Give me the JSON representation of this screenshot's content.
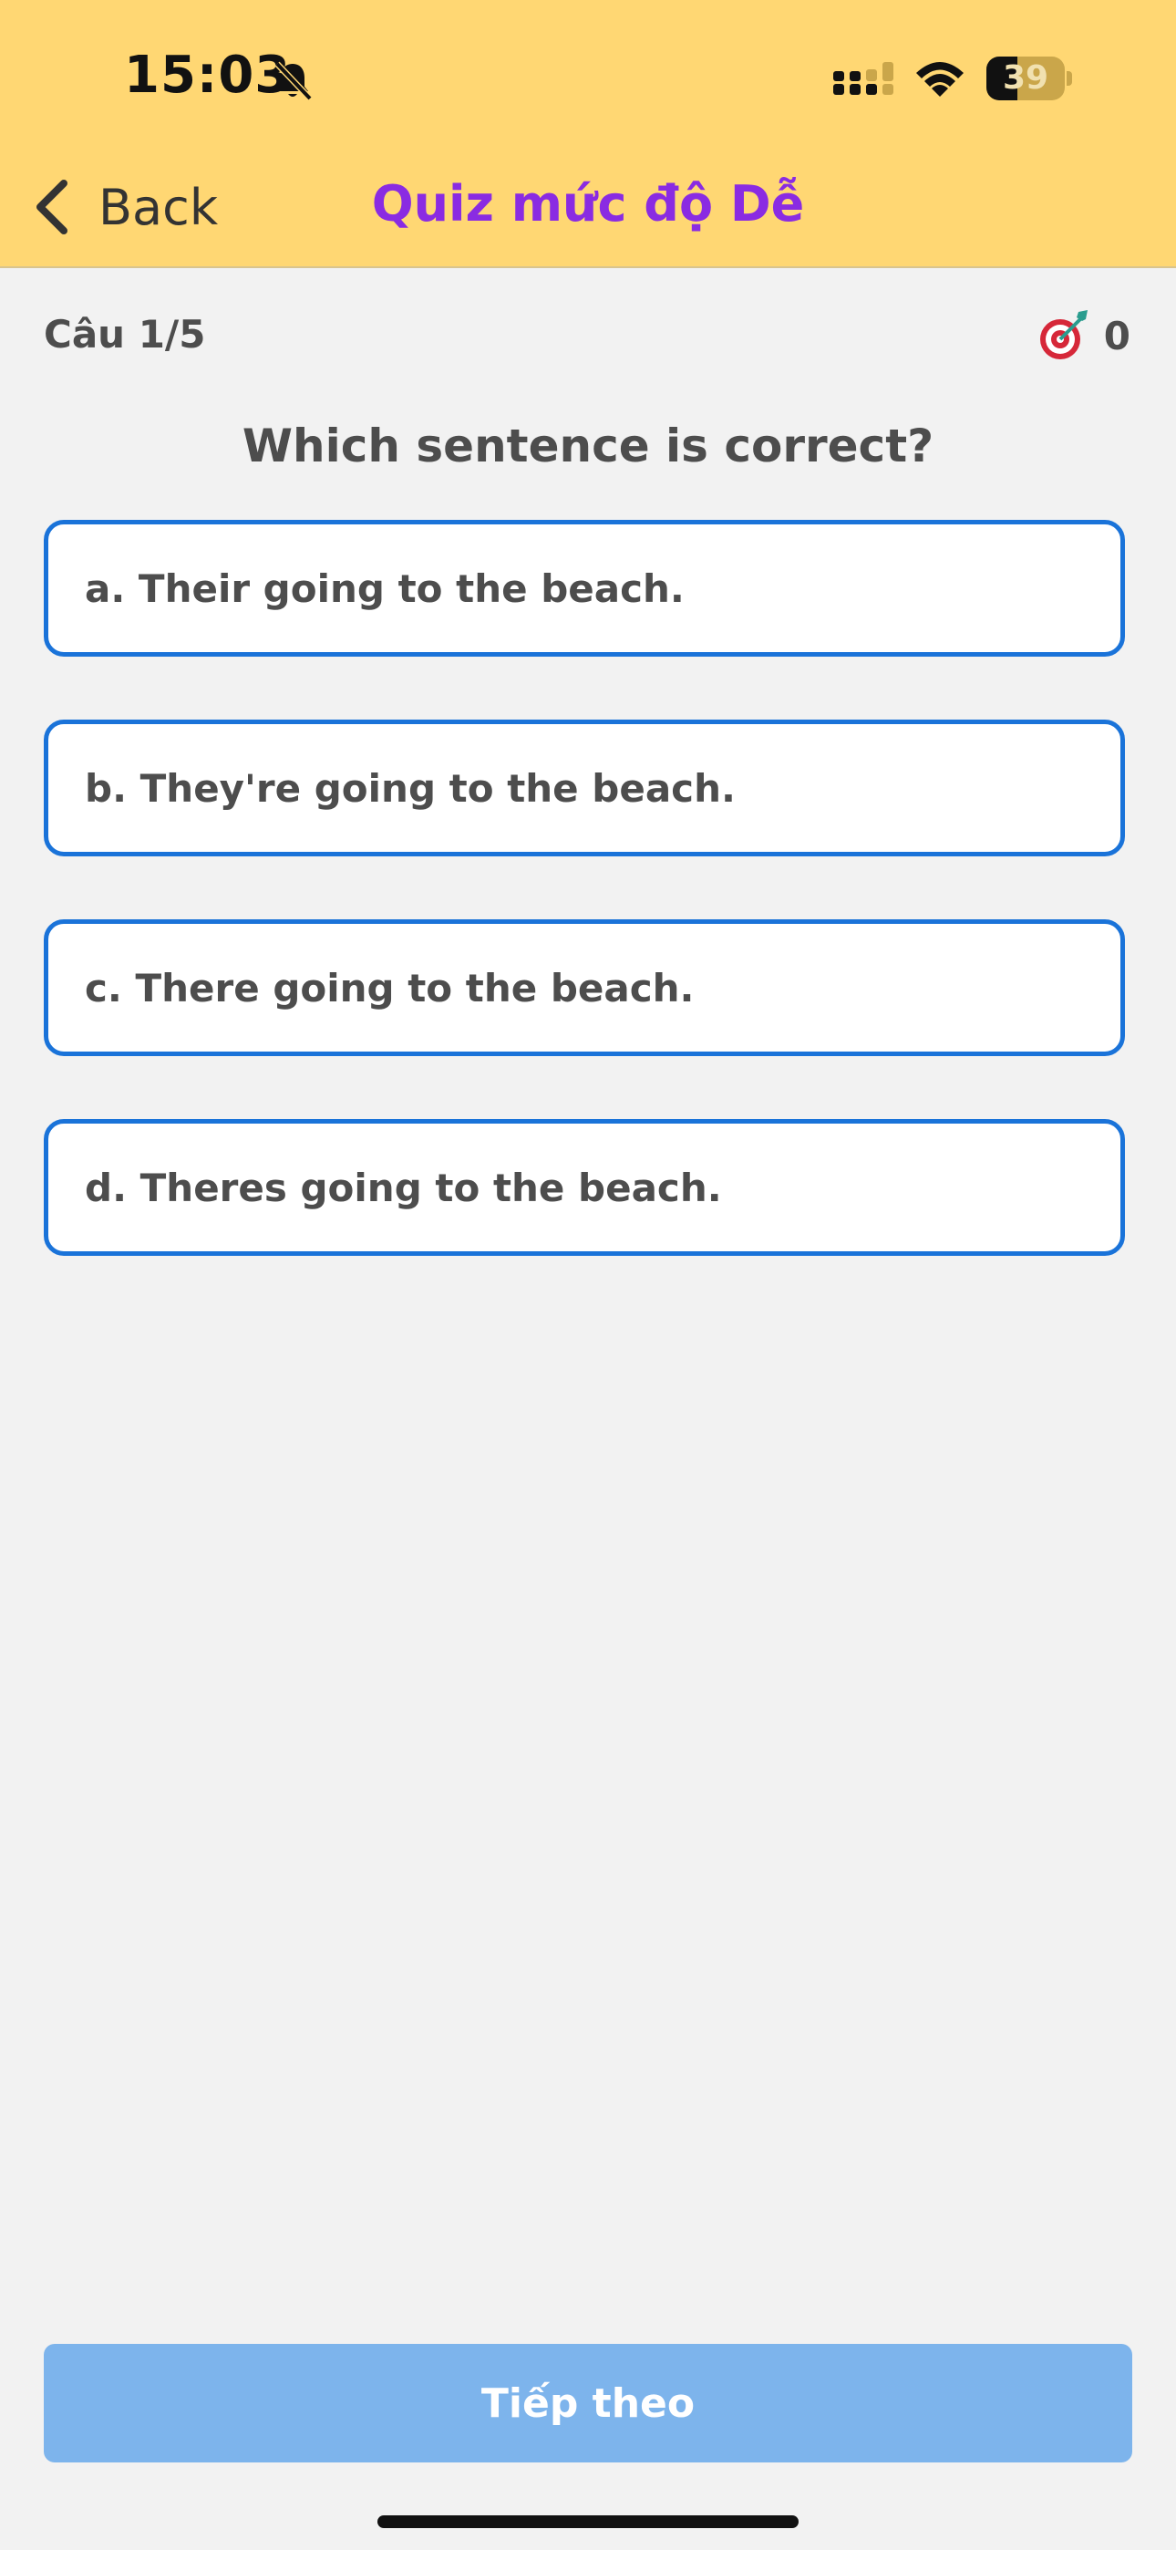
{
  "status_bar": {
    "time": "15:03",
    "battery_level": "39",
    "icons": [
      "bell-slash-icon",
      "cellular-signal-icon",
      "wifi-icon",
      "battery-icon"
    ]
  },
  "nav": {
    "back_label": "Back",
    "title": "Quiz mức độ Dễ"
  },
  "quiz": {
    "progress": "Câu 1/5",
    "score": "0",
    "question": "Which sentence is correct?",
    "options": [
      {
        "label": "a. Their going to the beach."
      },
      {
        "label": "b. They're going to the beach."
      },
      {
        "label": "c. There going to the beach."
      },
      {
        "label": "d. Theres going to the beach."
      }
    ]
  },
  "footer": {
    "next_label": "Tiếp theo"
  },
  "colors": {
    "header_bg": "#ffd773",
    "title": "#8a2be2",
    "option_border": "#1a73d9",
    "next_button_bg": "#7db4ec",
    "page_bg": "#f2f2f2"
  }
}
